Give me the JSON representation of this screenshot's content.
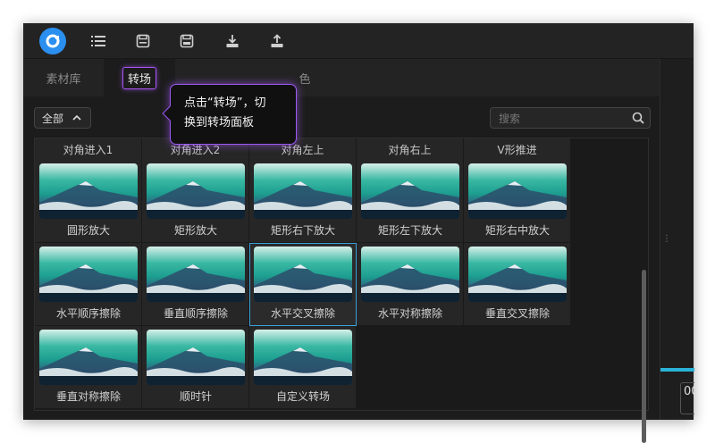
{
  "toolbar": {
    "icons": [
      "app-logo",
      "list-icon",
      "save-icon",
      "save-as-icon",
      "import-icon",
      "export-icon"
    ]
  },
  "tabs": [
    {
      "label": "素材库"
    },
    {
      "label": "转场"
    },
    {
      "label": "色"
    }
  ],
  "tooltip": {
    "line1": "点击“转场”，切",
    "line2": "换到转场面板"
  },
  "filter": {
    "label": "全部"
  },
  "search": {
    "placeholder": "搜索"
  },
  "grid": {
    "headers": [
      "对角进入1",
      "对角进入2",
      "对角左上",
      "对角右上",
      "V形推进"
    ],
    "items": [
      [
        "圆形放大",
        "矩形放大",
        "矩形右下放大",
        "矩形左下放大",
        "矩形右中放大"
      ],
      [
        "水平顺序擦除",
        "垂直顺序擦除",
        "水平交叉擦除",
        "水平对称擦除",
        "垂直交叉擦除"
      ],
      [
        "垂直对称擦除",
        "顺时针",
        "自定义转场"
      ]
    ],
    "selected": "水平交叉擦除"
  },
  "right_panel": {
    "timecode": "00"
  },
  "colors": {
    "accent_purple": "#a855f7",
    "selection_blue": "#3aa0d8",
    "logo_blue": "#2b8ff0",
    "timeline_cyan": "#2ab3d8"
  }
}
